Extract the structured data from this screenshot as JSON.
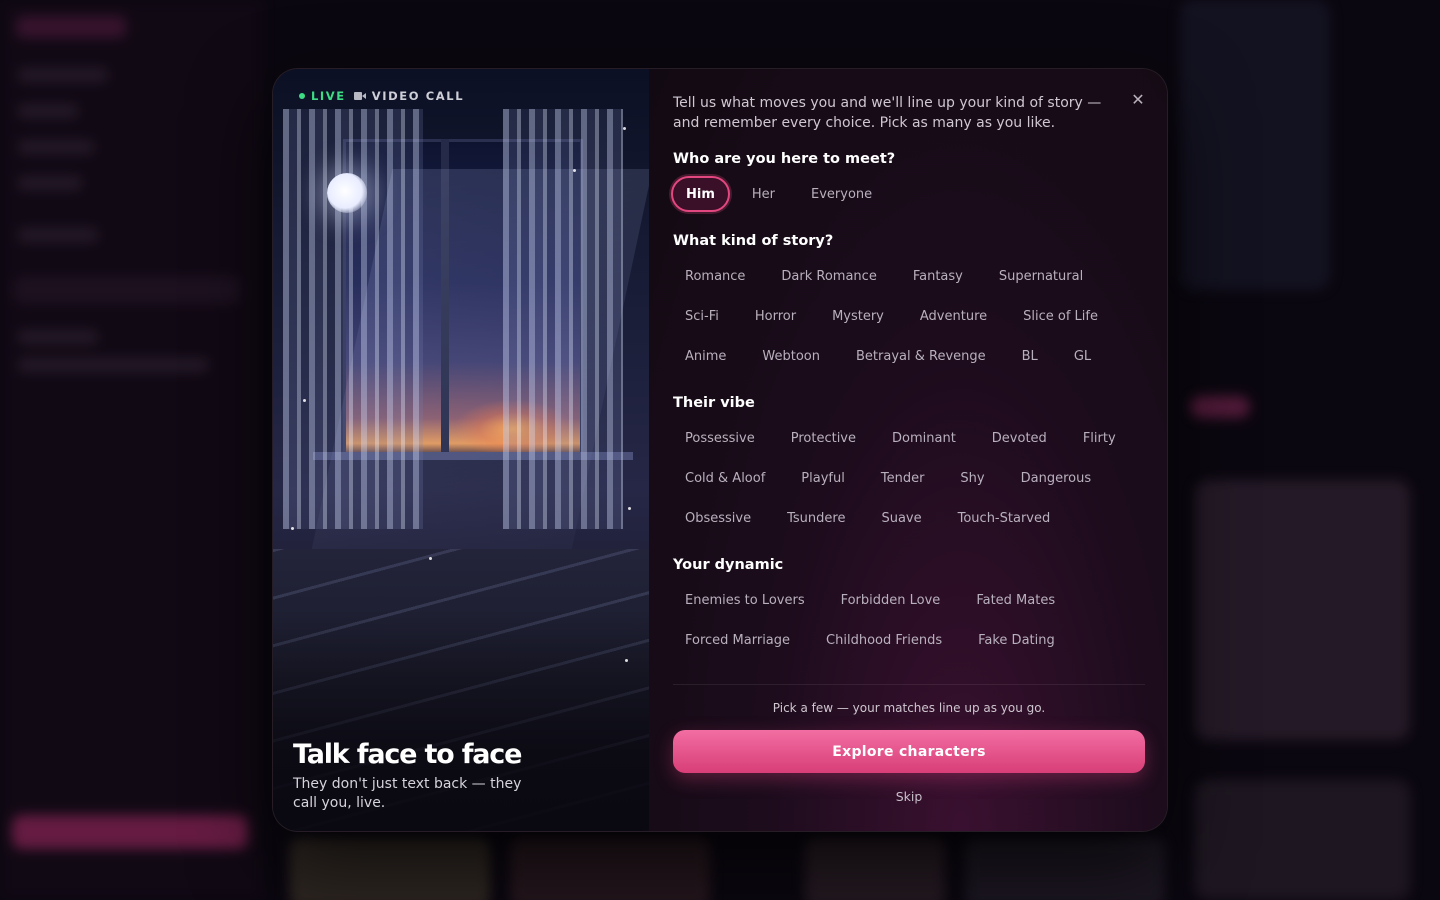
{
  "visual": {
    "live_label": "LIVE",
    "call_label": "VIDEO CALL",
    "title": "Talk face to face",
    "subtitle": "They don't just text back — they call you, live."
  },
  "intro": "Tell us what moves you and we'll line up your kind of story — and remember every choice. Pick as many as you like.",
  "sections": {
    "meet": {
      "title": "Who are you here to meet?",
      "options": [
        "Him",
        "Her",
        "Everyone"
      ],
      "selected": "Him"
    },
    "story": {
      "title": "What kind of story?",
      "rows": [
        [
          "Romance",
          "Dark Romance",
          "Fantasy",
          "Supernatural"
        ],
        [
          "Sci-Fi",
          "Horror",
          "Mystery",
          "Adventure",
          "Slice of Life"
        ],
        [
          "Anime",
          "Webtoon",
          "Betrayal & Revenge",
          "BL",
          "GL"
        ]
      ]
    },
    "vibe": {
      "title": "Their vibe",
      "rows": [
        [
          "Possessive",
          "Protective",
          "Dominant",
          "Devoted",
          "Flirty"
        ],
        [
          "Cold & Aloof",
          "Playful",
          "Tender",
          "Shy",
          "Dangerous"
        ],
        [
          "Obsessive",
          "Tsundere",
          "Suave",
          "Touch-Starved"
        ]
      ]
    },
    "dynamic": {
      "title": "Your dynamic",
      "rows": [
        [
          "Enemies to Lovers",
          "Forbidden Love",
          "Fated Mates"
        ],
        [
          "Forced Marriage",
          "Childhood Friends",
          "Fake Dating"
        ]
      ]
    }
  },
  "footer": {
    "hint": "Pick a few — your matches line up as you go.",
    "cta": "Explore characters",
    "skip": "Skip"
  },
  "close_icon": "close-icon",
  "colors": {
    "accent": "#e2477f",
    "cta_top": "#f26ea2",
    "cta_bottom": "#d83e78",
    "live": "#3ddc84"
  }
}
